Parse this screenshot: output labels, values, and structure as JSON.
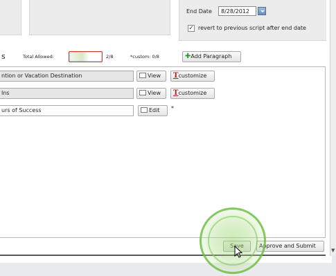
{
  "schedule": {
    "end_date_label": "End Date",
    "end_date_value": "8/28/2012",
    "revert_checked": true,
    "revert_label": "revert to previous script after end date"
  },
  "paragraphs_header": {
    "section_letter": "s",
    "total_allowed_label": "Total Allowed:",
    "total_allowed_count": "2/8",
    "custom_count": "*custom: 0/8",
    "add_paragraph_label": "Add Paragraph"
  },
  "paragraph_rows": [
    {
      "title": "ntion or Vacation Destination",
      "action_label": "View",
      "customize_label": "customize"
    },
    {
      "title": "Ins",
      "action_label": "View",
      "customize_label": "customize"
    },
    {
      "title": "urs of Success",
      "action_label": "Edit",
      "marker": "*"
    }
  ],
  "footer": {
    "save_label": "Save",
    "approve_label": "Approve and Submit"
  },
  "icons": {
    "add": "plus-icon",
    "view": "document-icon",
    "customize": "text-format-icon",
    "date_picker": "calendar-dropdown-icon",
    "cursor": "mouse-pointer-icon"
  },
  "colors": {
    "add_icon": "#2e9a2e",
    "customize_icon": "#b02020",
    "click_highlight": "#6ebe46"
  }
}
